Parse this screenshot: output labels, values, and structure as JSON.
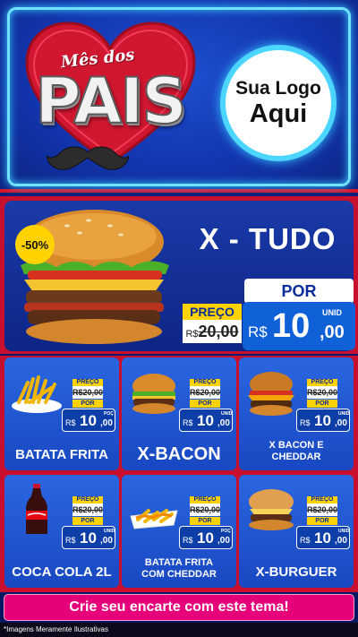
{
  "header": {
    "title_small": "Mês dos",
    "title_big": "PAIS",
    "logo_line1": "Sua Logo",
    "logo_line2": "Aqui"
  },
  "featured": {
    "discount": "-50%",
    "name": "X - TUDO",
    "preco_label": "PREÇO",
    "old_prefix": "R$",
    "old_price": "20,00",
    "por_label": "POR",
    "currency": "R$",
    "price_int": "10",
    "price_dec": ",00",
    "unit": "UNID"
  },
  "tags": {
    "preco_label": "PREÇO",
    "old_price": "R$20,00",
    "por_label": "POR",
    "currency": "R$",
    "price_int": "10",
    "price_dec": ",00"
  },
  "products": [
    {
      "name": "BATATA FRITA",
      "unit": "POÇ"
    },
    {
      "name": "X-BACON",
      "unit": "UNID"
    },
    {
      "name": "X BACON E CHEDDAR",
      "unit": "UNID"
    },
    {
      "name": "COCA COLA 2L",
      "unit": "UNID"
    },
    {
      "name": "BATATA FRITA COM CHEDDAR",
      "unit": "POÇ"
    },
    {
      "name": "X-BURGUER",
      "unit": "UNID"
    }
  ],
  "cta": "Crie seu encarte com este tema!",
  "footer_note": "*Imagens Meramente Ilustrativas",
  "colors": {
    "primary_blue": "#1848c2",
    "brand_red": "#c8102e",
    "accent_yellow": "#ffd200",
    "cta_pink": "#e6007a",
    "neon_cyan": "#6fe3ff"
  }
}
